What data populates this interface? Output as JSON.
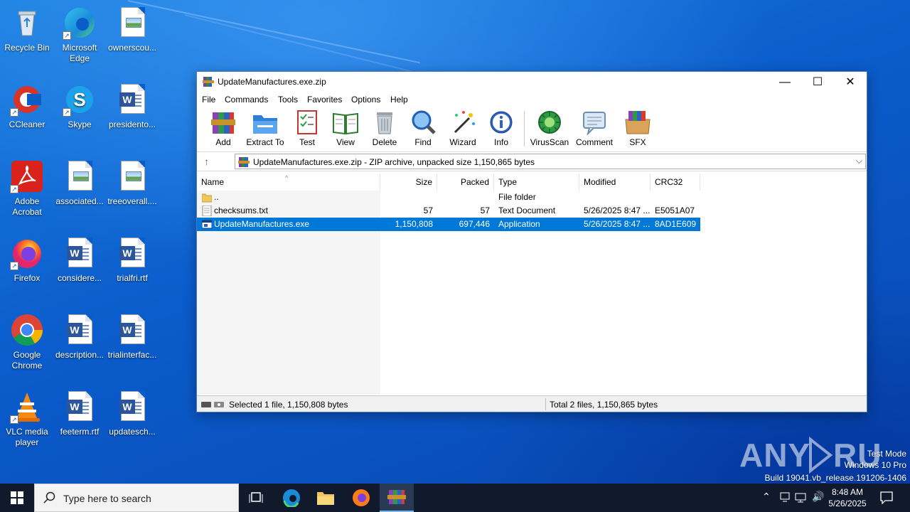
{
  "desktop": {
    "icons": [
      {
        "label": "Recycle Bin",
        "icon": "recycle-bin-icon"
      },
      {
        "label": "Microsoft Edge",
        "icon": "edge-icon"
      },
      {
        "label": "ownerscou...",
        "icon": "image-file-icon"
      },
      {
        "label": "CCleaner",
        "icon": "ccleaner-icon"
      },
      {
        "label": "Skype",
        "icon": "skype-icon"
      },
      {
        "label": "presidento...",
        "icon": "word-file-icon"
      },
      {
        "label": "Adobe Acrobat",
        "icon": "acrobat-icon"
      },
      {
        "label": "associated...",
        "icon": "image-file-icon"
      },
      {
        "label": "treeoverall....",
        "icon": "image-file-icon"
      },
      {
        "label": "Firefox",
        "icon": "firefox-icon"
      },
      {
        "label": "considere...",
        "icon": "word-file-icon"
      },
      {
        "label": "trialfri.rtf",
        "icon": "word-file-icon"
      },
      {
        "label": "Google Chrome",
        "icon": "chrome-icon"
      },
      {
        "label": "description...",
        "icon": "word-file-icon"
      },
      {
        "label": "trialinterfac...",
        "icon": "word-file-icon"
      },
      {
        "label": "VLC media player",
        "icon": "vlc-icon"
      },
      {
        "label": "feeterm.rtf",
        "icon": "word-file-icon"
      },
      {
        "label": "updatesch...",
        "icon": "word-file-icon"
      }
    ]
  },
  "window": {
    "title": "UpdateManufactures.exe.zip",
    "controls": {
      "minimize": "—",
      "maximize": "☐",
      "close": "✕"
    },
    "menu": [
      "File",
      "Commands",
      "Tools",
      "Favorites",
      "Options",
      "Help"
    ],
    "toolbar": [
      {
        "label": "Add",
        "icon": "add-archive-icon"
      },
      {
        "label": "Extract To",
        "icon": "extract-folder-icon"
      },
      {
        "label": "Test",
        "icon": "test-checklist-icon"
      },
      {
        "label": "View",
        "icon": "view-book-icon"
      },
      {
        "label": "Delete",
        "icon": "trash-icon"
      },
      {
        "label": "Find",
        "icon": "magnifier-icon"
      },
      {
        "label": "Wizard",
        "icon": "wizard-wand-icon"
      },
      {
        "label": "Info",
        "icon": "info-icon"
      },
      {
        "label": "VirusScan",
        "icon": "virus-scan-icon"
      },
      {
        "label": "Comment",
        "icon": "comment-icon"
      },
      {
        "label": "SFX",
        "icon": "sfx-box-icon"
      }
    ],
    "path": "UpdateManufactures.exe.zip - ZIP archive, unpacked size 1,150,865 bytes",
    "columns": [
      "Name",
      "Size",
      "Packed",
      "Type",
      "Modified",
      "CRC32"
    ],
    "files": [
      {
        "name": "..",
        "size": "",
        "packed": "",
        "type": "File folder",
        "modified": "",
        "crc": "",
        "icon": "folder-icon"
      },
      {
        "name": "checksums.txt",
        "size": "57",
        "packed": "57",
        "type": "Text Document",
        "modified": "5/26/2025 8:47 ...",
        "crc": "E5051A07",
        "icon": "text-file-icon"
      },
      {
        "name": "UpdateManufactures.exe",
        "size": "1,150,808",
        "packed": "697,446",
        "type": "Application",
        "modified": "5/26/2025 8:47 ...",
        "crc": "8AD1E609",
        "icon": "exe-file-icon",
        "selected": true
      }
    ],
    "status_left": "Selected 1 file, 1,150,808 bytes",
    "status_right": "Total 2 files, 1,150,865 bytes"
  },
  "taskbar": {
    "search_placeholder": "Type here to search",
    "time": "8:48 AM",
    "date": "5/26/2025"
  },
  "watermark": {
    "brand": "ANY RUN",
    "line1": "Test Mode",
    "line2": "Windows 10 Pro",
    "line3": "Build 19041.vb_release.191206-1406"
  }
}
